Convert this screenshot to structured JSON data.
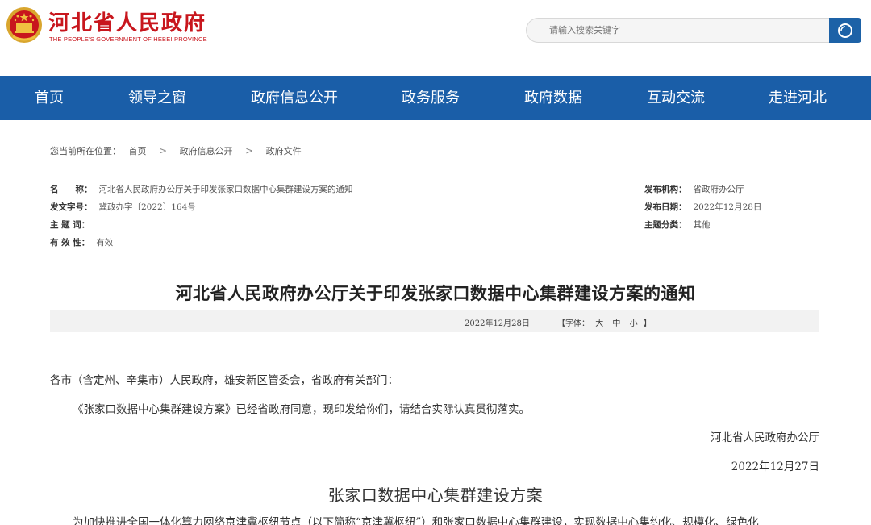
{
  "header": {
    "title": "河北省人民政府",
    "subtitle": "THE PEOPLE'S GOVERNMENT OF HEBEI PROVINCE",
    "emblem_icon": "national-emblem-icon",
    "search_placeholder": "请输入搜索关键字",
    "search_icon": "search-icon",
    "colors": {
      "brand_red": "#c8161d",
      "nav_blue": "#1a5ea8"
    }
  },
  "nav": {
    "items": [
      "首页",
      "领导之窗",
      "政府信息公开",
      "政务服务",
      "政府数据",
      "互动交流",
      "走进河北"
    ]
  },
  "breadcrumb": {
    "prefix": "您当前所在位置：",
    "items": [
      "首页",
      "政府信息公开",
      "政府文件"
    ],
    "separator": ">"
  },
  "meta": {
    "name_label": "名　　称：",
    "name_value": "河北省人民政府办公厅关于印发张家口数据中心集群建设方案的通知",
    "doc_no_label": "发文字号：",
    "doc_no_value": "冀政办字〔2022〕164号",
    "keywords_label": "主 题 词：",
    "keywords_value": "",
    "validity_label": "有 效 性：",
    "validity_value": "有效",
    "org_label": "发布机构：",
    "org_value": "省政府办公厅",
    "date_label": "发布日期：",
    "date_value": "2022年12月28日",
    "category_label": "主题分类：",
    "category_value": "其他"
  },
  "doc": {
    "title": "河北省人民政府办公厅关于印发张家口数据中心集群建设方案的通知",
    "date": "2022年12月28日",
    "font_label_open": "【字体：",
    "font_large": "大",
    "font_medium": "中",
    "font_small": "小",
    "font_label_close": "】",
    "salutation": "各市（含定州、辛集市）人民政府，雄安新区管委会，省政府有关部门：",
    "body_p1": "《张家口数据中心集群建设方案》已经省政府同意，现印发给你们，请结合实际认真贯彻落实。",
    "signature": "河北省人民政府办公厅",
    "sign_date": "2022年12月27日",
    "plan_title": "张家口数据中心集群建设方案",
    "plan_intro": "为加快推进全国一体化算力网络京津冀枢纽节点（以下简称“京津冀枢纽”）和张家口数据中心集群建设，实现数据中心集约化、规模化、绿色化"
  }
}
